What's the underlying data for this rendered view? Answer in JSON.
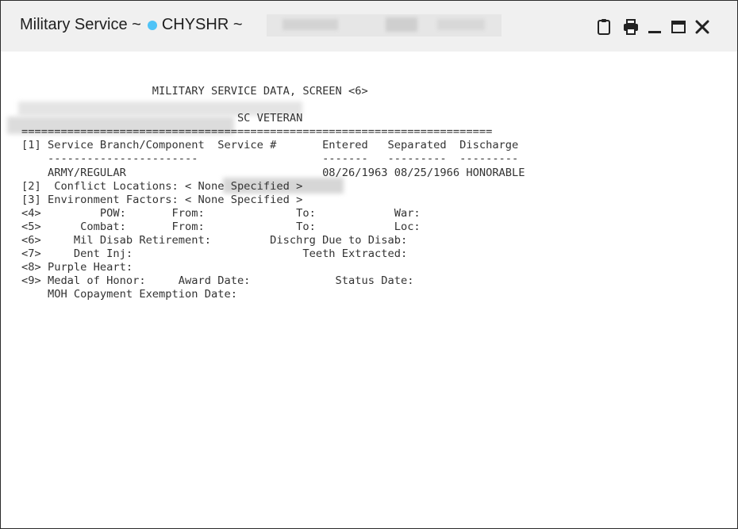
{
  "window": {
    "title_prefix": "Military Service ~",
    "title_patient": "CHYSHR ~",
    "status_dot_color": "#4fc3f7",
    "icons": [
      "clipboard-icon",
      "print-icon",
      "minimize-icon",
      "maximize-icon",
      "close-icon"
    ]
  },
  "report": {
    "line_01": "                    MILITARY SERVICE DATA, SCREEN <6>",
    "line_02": "",
    "line_03": "                                 SC VETERAN",
    "line_04": "========================================================================",
    "line_05": "[1] Service Branch/Component  Service #       Entered   Separated  Discharge",
    "line_06": "    -----------------------                   -------   ---------  ---------",
    "line_07": "    ARMY/REGULAR                              08/26/1963 08/25/1966 HONORABLE",
    "line_08": "[2]  Conflict Locations: < None Specified >",
    "line_09": "[3] Environment Factors: < None Specified >",
    "line_10": "<4>         POW:       From:              To:            War:",
    "line_11": "<5>      Combat:       From:              To:            Loc:",
    "line_12": "<6>     Mil Disab Retirement:         Dischrg Due to Disab:",
    "line_13": "<7>     Dent Inj:                          Teeth Extracted:",
    "line_14": "<8> Purple Heart:",
    "line_15": "<9> Medal of Honor:     Award Date:             Status Date:",
    "line_16": "    MOH Copayment Exemption Date:"
  }
}
